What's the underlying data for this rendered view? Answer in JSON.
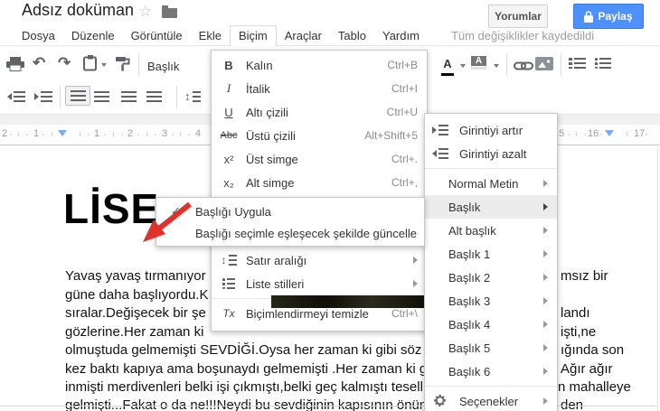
{
  "header": {
    "title": "Adsız doküman",
    "comments_label": "Yorumlar",
    "share_label": "Paylaş",
    "saved_status": "Tüm değişiklikler kaydedildi"
  },
  "menubar": {
    "items": [
      {
        "label": "Dosya"
      },
      {
        "label": "Düzenle"
      },
      {
        "label": "Görüntüle"
      },
      {
        "label": "Ekle"
      },
      {
        "label": "Biçim",
        "active": true
      },
      {
        "label": "Araçlar"
      },
      {
        "label": "Tablo"
      },
      {
        "label": "Yardım"
      }
    ]
  },
  "toolbar": {
    "style_selector": "Başlık",
    "glyphs": {
      "undo": "↶",
      "redo": "↷",
      "color_a": "A",
      "highlight_a": "A",
      "line_spacing_arrow": "↕"
    }
  },
  "ruler": {
    "marks": [
      "2",
      "1",
      "1",
      "2",
      "3",
      "4",
      "15",
      "16",
      "17"
    ]
  },
  "format_menu": {
    "items": [
      {
        "glyph": "B",
        "label": "Kalın",
        "shortcut": "Ctrl+B"
      },
      {
        "glyph": "I",
        "label": "İtalik",
        "shortcut": "Ctrl+I"
      },
      {
        "glyph": "U",
        "label": "Altı çizili",
        "shortcut": "Ctrl+U"
      },
      {
        "glyph": "Abc",
        "label": "Üstü çizili",
        "shortcut": "Alt+Shift+5"
      },
      {
        "glyph": "x²",
        "label": "Üst simge",
        "shortcut": "Ctrl+."
      },
      {
        "glyph": "x₂",
        "label": "Alt simge",
        "shortcut": "Ctrl+,"
      },
      {
        "glyph": "↕",
        "label": "Satır aralığı",
        "shortcut": ""
      },
      {
        "glyph": "",
        "label": "Liste stilleri",
        "shortcut": ""
      },
      {
        "glyph": "Tx",
        "label": "Biçimlendirmeyi temizle",
        "shortcut": "Ctrl+\\"
      }
    ]
  },
  "styles_submenu": {
    "indent_increase": "Girintiyi artır",
    "indent_decrease": "Girintiyi azalt",
    "styles": [
      "Normal Metin",
      "Başlık",
      "Alt başlık",
      "Başlık 1",
      "Başlık 2",
      "Başlık 3",
      "Başlık 4",
      "Başlık 5",
      "Başlık 6"
    ],
    "highlighted": "Başlık",
    "options": "Seçenekler"
  },
  "heading_popup": {
    "check_glyph": "✓",
    "apply": "Başlığı Uygula",
    "update": "Başlığı seçimle eşleşecek şekilde güncelle"
  },
  "document": {
    "heading": "LİSE",
    "lines": [
      {
        "left": "Yavaş yavaş tırmanıyor",
        "right": "msız bir"
      },
      {
        "left": "güne daha başlıyordu.K",
        "right": ""
      },
      {
        "left": "sıralar.Değişecek bir şe",
        "right": "landı"
      },
      {
        "left": "gözlerine.Her zaman ki",
        "right": "işti,ne"
      },
      {
        "left": "olmuştuda gelmemişti SEVDİĞİ.Oysa her zaman ki gibi söz",
        "right": "ığında son"
      },
      {
        "left": "kez baktı kapıya ama boşunaydı gelmemişti .Her zaman ki g",
        "right": "Ağır ağır"
      },
      {
        "left": "inmişti merdivenleri belki işi çıkmıştı,belki geç kalmıştı tesell",
        "right": "n mahalleye"
      },
      {
        "left": "gelmişti...Fakat o da ne!!!Neydi bu sevdiğinin kapısının önün",
        "right": "den"
      }
    ]
  },
  "colors": {
    "accent_blue": "#4d90fe",
    "annotation_red": "#e0312a",
    "ruler_marker": "#7baaf7"
  }
}
